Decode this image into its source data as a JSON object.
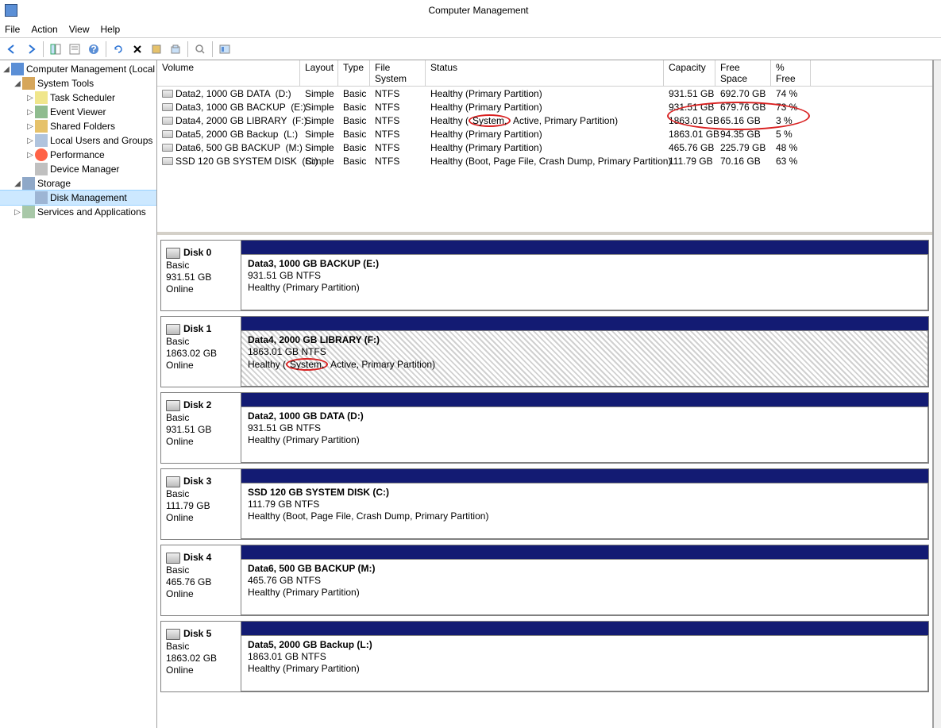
{
  "title": "Computer Management",
  "menu": {
    "file": "File",
    "action": "Action",
    "view": "View",
    "help": "Help"
  },
  "tree": {
    "root": "Computer Management (Local",
    "system_tools": "System Tools",
    "task_scheduler": "Task Scheduler",
    "event_viewer": "Event Viewer",
    "shared_folders": "Shared Folders",
    "local_users": "Local Users and Groups",
    "performance": "Performance",
    "device_manager": "Device Manager",
    "storage": "Storage",
    "disk_management": "Disk Management",
    "services": "Services and Applications"
  },
  "vol_headers": {
    "volume": "Volume",
    "layout": "Layout",
    "type": "Type",
    "filesystem": "File System",
    "status": "Status",
    "capacity": "Capacity",
    "freespace": "Free Space",
    "pctfree": "% Free"
  },
  "volumes": [
    {
      "name": "Data2, 1000 GB  DATA",
      "letter": "(D:)",
      "layout": "Simple",
      "type": "Basic",
      "fs": "NTFS",
      "status": "Healthy (Primary Partition)",
      "capacity": "931.51 GB",
      "free": "692.70 GB",
      "pct": "74 %"
    },
    {
      "name": "Data3, 1000 GB BACKUP",
      "letter": "(E:)",
      "layout": "Simple",
      "type": "Basic",
      "fs": "NTFS",
      "status": "Healthy (Primary Partition)",
      "capacity": "931.51 GB",
      "free": "679.76 GB",
      "pct": "73 %"
    },
    {
      "name": "Data4,  2000 GB LIBRARY",
      "letter": "(F:)",
      "layout": "Simple",
      "type": "Basic",
      "fs": "NTFS",
      "status_pre": "Healthy (",
      "status_sys": "System,",
      "status_post": " Active, Primary Partition)",
      "capacity": "1863.01 GB",
      "free": "65.16 GB",
      "pct": "3 %"
    },
    {
      "name": "Data5, 2000 GB Backup",
      "letter": "(L:)",
      "layout": "Simple",
      "type": "Basic",
      "fs": "NTFS",
      "status": "Healthy (Primary Partition)",
      "capacity": "1863.01 GB",
      "free": "94.35 GB",
      "pct": "5 %"
    },
    {
      "name": "Data6,  500 GB BACKUP",
      "letter": "(M:)",
      "layout": "Simple",
      "type": "Basic",
      "fs": "NTFS",
      "status": "Healthy (Primary Partition)",
      "capacity": "465.76 GB",
      "free": "225.79 GB",
      "pct": "48 %"
    },
    {
      "name": "SSD 120 GB  SYSTEM DISK",
      "letter": "(C:)",
      "layout": "Simple",
      "type": "Basic",
      "fs": "NTFS",
      "status": "Healthy (Boot, Page File, Crash Dump, Primary Partition)",
      "capacity": "111.79 GB",
      "free": "70.16 GB",
      "pct": "63 %"
    }
  ],
  "disks": [
    {
      "name": "Disk 0",
      "type": "Basic",
      "size": "931.51 GB",
      "state": "Online",
      "part_name": "Data3, 1000 GB BACKUP     (E:)",
      "part_line2": "931.51 GB NTFS",
      "part_line3": "Healthy (Primary Partition)",
      "hatched": false
    },
    {
      "name": "Disk 1",
      "type": "Basic",
      "size": "1863.02 GB",
      "state": "Online",
      "part_name": "Data4,  2000 GB LIBRARY    (F:)",
      "part_line2": "1863.01 GB NTFS",
      "part_line3_pre": "Healthy (",
      "part_line3_sys": "System,",
      "part_line3_post": " Active, Primary Partition)",
      "hatched": true
    },
    {
      "name": "Disk 2",
      "type": "Basic",
      "size": "931.51 GB",
      "state": "Online",
      "part_name": "Data2, 1000 GB  DATA          (D:)",
      "part_line2": "931.51 GB NTFS",
      "part_line3": "Healthy (Primary Partition)",
      "hatched": false
    },
    {
      "name": "Disk 3",
      "type": "Basic",
      "size": "111.79 GB",
      "state": "Online",
      "part_name": "SSD 120 GB  SYSTEM DISK  (C:)",
      "part_line2": "111.79 GB NTFS",
      "part_line3": "Healthy (Boot, Page File, Crash Dump, Primary Partition)",
      "hatched": false
    },
    {
      "name": "Disk 4",
      "type": "Basic",
      "size": "465.76 GB",
      "state": "Online",
      "part_name": "Data6,  500 GB BACKUP      (M:)",
      "part_line2": "465.76 GB NTFS",
      "part_line3": "Healthy (Primary Partition)",
      "hatched": false
    },
    {
      "name": "Disk 5",
      "type": "Basic",
      "size": "1863.02 GB",
      "state": "Online",
      "part_name": "Data5, 2000 GB Backup       (L:)",
      "part_line2": "1863.01 GB NTFS",
      "part_line3": "Healthy (Primary Partition)",
      "hatched": false
    }
  ]
}
